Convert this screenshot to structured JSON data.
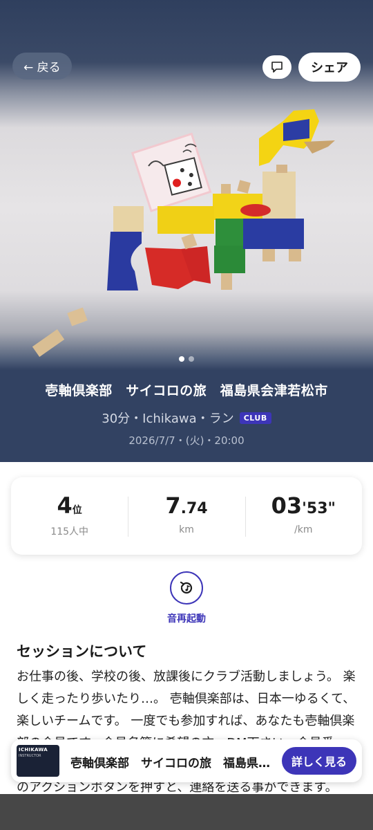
{
  "header": {
    "back_label": "← 戻る",
    "share_label": "シェア",
    "comment_icon": "comment-icon"
  },
  "carousel": {
    "page_count": 2,
    "active_index": 0
  },
  "session": {
    "title": "壱軸倶楽部　サイコロの旅　福島県会津若松市",
    "meta": "30分・Ichikawa・ラン",
    "badge": "CLUB",
    "date": "2026/7/7・(火)・20:00"
  },
  "stats": {
    "rank": {
      "value": "4",
      "unit": "位",
      "sub": "115人中"
    },
    "distance": {
      "int": "7",
      "dec": ".74",
      "unit": "km"
    },
    "pace": {
      "min": "03",
      "min_mark": "'",
      "sec": "53",
      "sec_mark": "\"",
      "unit": "/km"
    }
  },
  "voice": {
    "label": "音再起動",
    "icon": "replay-icon"
  },
  "about": {
    "heading": "セッションについて",
    "text": "お仕事の後、学校の後、放課後にクラブ活動しましょう。 楽しく走ったり歩いたり…。 壱軸倶楽部は、日本一ゆるくて、楽しいチームです。 一度でも参加すれば、あなたも壱軸倶楽部の会員です。会員名簿に希望の方、DM下さい。会員番号、役職係を登録致します。 アプリセッションページの右下のアクションボタンを押すと、連絡を送る事ができます。"
  },
  "sticky": {
    "thumb_title": "ICHIKAWA",
    "thumb_sub": "INSTRUCTOR",
    "title": "壱軸倶楽部　サイコロの旅　福島県会津若松市",
    "button": "詳しく見る"
  },
  "colors": {
    "accent": "#3d35b8",
    "hero_bg": "#324262"
  }
}
